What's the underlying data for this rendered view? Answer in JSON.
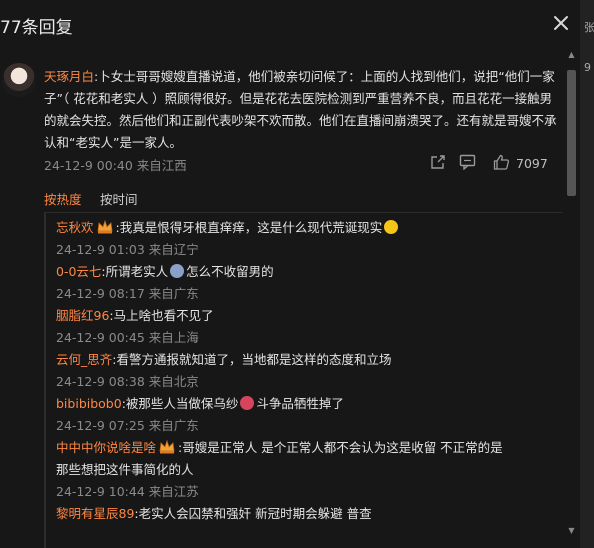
{
  "header": {
    "title": "77条回复"
  },
  "edge": {
    "chars": [
      "张",
      "9"
    ]
  },
  "main_comment": {
    "user": "天琢月白",
    "sep": ":",
    "text": "卜女士哥哥嫂嫂直播说道，他们被亲切问候了：上面的人找到他们，说把“他们一家子”（ 花花和老实人 ）照顾得很好。但是花花去医院检测到严重营养不良，而且花花一接触男的就会失控。然后他们和正副代表吵架不欢而散。他们在直播间崩溃哭了。还有就是哥嫂不承认和“老实人”是一家人。",
    "meta": "24-12-9 00:40 来自江西",
    "likes": "7097"
  },
  "sort_tabs": {
    "hot": "按热度",
    "time": "按时间"
  },
  "replies": [
    {
      "user": "忘秋欢",
      "text": ":我真是恨得牙根直痒痒，这是什么现代荒诞现实",
      "meta": "24-12-9 01:03 来自辽宁"
    },
    {
      "user": "0-0云七",
      "text_a": ":所谓老实人",
      "text_b": "怎么不收留男的",
      "meta": "24-12-9 08:17 来自广东"
    },
    {
      "user": "胭脂红96",
      "text": ":马上啥也看不见了",
      "meta": "24-12-9 00:45 来自上海"
    },
    {
      "user": "云何_思齐",
      "text": ":看警方通报就知道了，当地都是这样的态度和立场",
      "meta": "24-12-9 08:38 来自北京"
    },
    {
      "user": "bibibibob0",
      "text_a": ":被那些人当做保乌纱",
      "text_b": "斗争品牺牲掉了",
      "meta": "24-12-9 07:25 来自广东"
    },
    {
      "user": "中中中你说啥是啥",
      "text": ":哥嫂是正常人   是个正常人都不会认为这是收留    不正常的是",
      "text2": "那些想把这件事简化的人",
      "meta": "24-12-9 10:44 来自江苏"
    },
    {
      "user": "黎明有星辰89",
      "text": ":老实人会囚禁和强奸  新冠时期会躲避  普查"
    }
  ],
  "colors": {
    "accent": "#ff8744",
    "background": "#171717",
    "meta_text": "#8a8a8a"
  }
}
